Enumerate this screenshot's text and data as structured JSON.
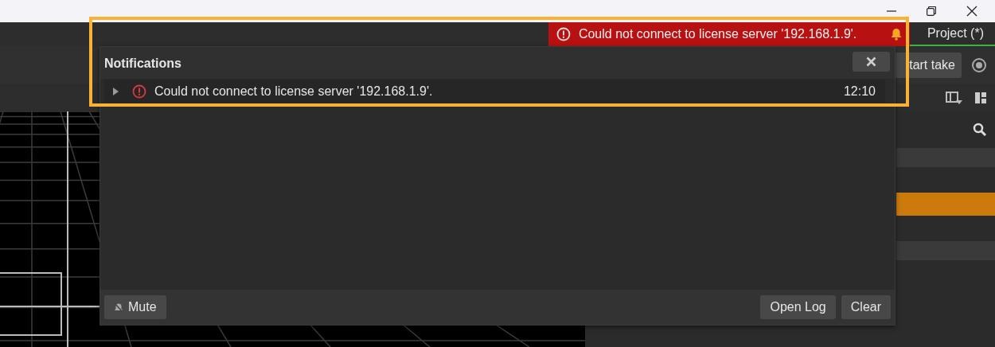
{
  "top_bar": {
    "error_banner": {
      "message": "Could not connect to license server '192.168.1.9'."
    },
    "tabs": [
      {
        "label": "Project (*)",
        "selected": true
      }
    ]
  },
  "toolbar": {
    "buttons": [
      {
        "label": "tart take"
      }
    ]
  },
  "sidebar": {
    "rows": [
      {
        "selected": false
      },
      {
        "selected": true
      },
      {
        "selected": false
      }
    ]
  },
  "notifications": {
    "title": "Notifications",
    "items": [
      {
        "expanded": false,
        "message": "Could not connect to license server '192.168.1.9'.",
        "time": "12:10"
      }
    ],
    "footer_left": [
      {
        "kind": "mute",
        "label": "Mute"
      }
    ],
    "footer_right": [
      {
        "label": "Open Log"
      },
      {
        "label": "Clear"
      }
    ]
  },
  "annotation": {
    "kind": "highlight-frame"
  }
}
